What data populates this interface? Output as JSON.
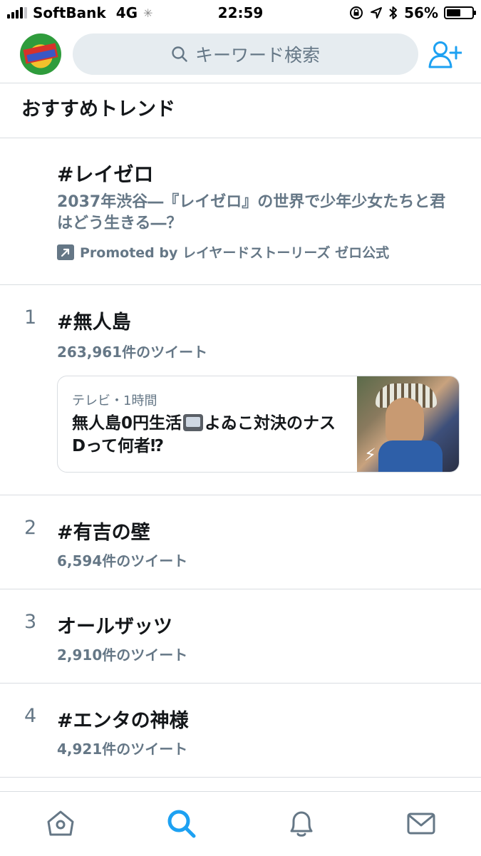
{
  "status_bar": {
    "carrier": "SoftBank",
    "network": "4G",
    "time": "22:59",
    "battery": "56%",
    "battery_level": 0.56
  },
  "header": {
    "search_placeholder": "キーワード検索"
  },
  "section_title": "おすすめトレンド",
  "promoted": {
    "title": "#レイゼロ",
    "description": "2037年渋谷―『レイゼロ』の世界で少年少女たちと君はどう生きる―？",
    "promoted_by": "Promoted by レイヤードストーリーズ ゼロ公式"
  },
  "trends": [
    {
      "rank": "1",
      "name": "#無人島",
      "count": "263,961件のツイート",
      "card": {
        "meta": "テレビ・1時間",
        "headline_before": "無人島0円生活",
        "headline_after": "よゐこ対決のナスDって何者⁉︎"
      }
    },
    {
      "rank": "2",
      "name": "#有吉の壁",
      "count": "6,594件のツイート"
    },
    {
      "rank": "3",
      "name": "オールザッツ",
      "count": "2,910件のツイート"
    },
    {
      "rank": "4",
      "name": "#エンタの神様",
      "count": "4,921件のツイート"
    }
  ],
  "tabs": [
    {
      "name": "home-icon",
      "active": false
    },
    {
      "name": "search-icon",
      "active": true
    },
    {
      "name": "notifications-icon",
      "active": false
    },
    {
      "name": "messages-icon",
      "active": false
    }
  ],
  "colors": {
    "accent": "#1da1f2",
    "secondary_text": "#657786",
    "divider": "#d9dde1"
  }
}
